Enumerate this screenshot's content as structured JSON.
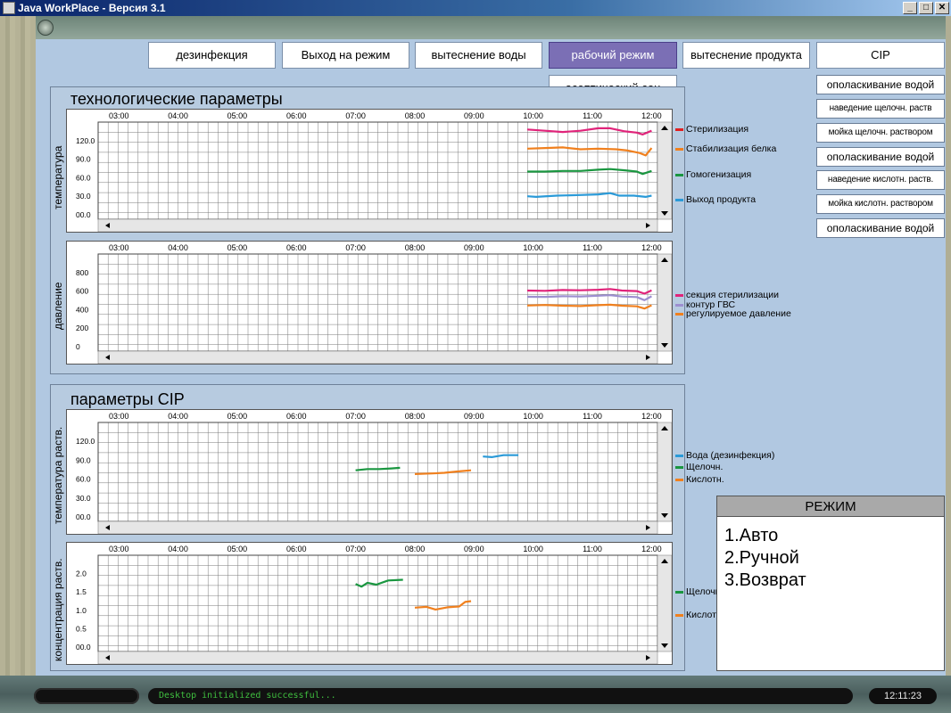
{
  "window": {
    "title": "Java WorkPlace - Версия 3.1",
    "minimize": "_",
    "maximize": "□",
    "close": "✕"
  },
  "mode_buttons": [
    {
      "label": "дезинфекция",
      "active": false
    },
    {
      "label": "Выход на режим",
      "active": false
    },
    {
      "label": "вытеснение воды",
      "active": false
    },
    {
      "label": "рабочий режим",
      "active": true
    },
    {
      "label": "вытеснение продукта",
      "active": false
    },
    {
      "label": "CIP",
      "active": false
    }
  ],
  "aseptic_button": "асептический сон",
  "cip_steps": [
    "ополаскивание водой",
    "наведение щелочн. раств",
    "мойка щелочн. раствором",
    "ополаскивание водой",
    "наведение кислотн. раств.",
    "мойка кислотн. раствором",
    "ополаскивание водой"
  ],
  "colors": {
    "pink": "#e0247a",
    "orange": "#f0801e",
    "green": "#1a9640",
    "blue": "#2a9ad8",
    "lavender": "#9c8fd0",
    "red": "#e02020",
    "active_button": "#7b6fb5"
  },
  "time_ticks": [
    "03:00",
    "04:00",
    "05:00",
    "06:00",
    "07:00",
    "08:00",
    "09:00",
    "10:00",
    "11:00",
    "12:00"
  ],
  "panels": {
    "tech": {
      "title": "технологические параметры"
    },
    "cip": {
      "title": "параметры CIP"
    }
  },
  "charts": [
    {
      "id": "temp",
      "ylabel": "температура",
      "yticks": [
        "120.0",
        "90.0",
        "60.0",
        "30.0",
        "00.0"
      ],
      "ylim": [
        0,
        150
      ],
      "legend": [
        {
          "name": "Стерилизация",
          "color": "#e02020"
        },
        {
          "name": "Стабилизация белка",
          "color": "#f0801e"
        },
        {
          "name": "Гомогенизация",
          "color": "#1a9640"
        },
        {
          "name": "Выход продукта",
          "color": "#2a9ad8"
        }
      ],
      "series": [
        {
          "name": "Стерилизация",
          "color": "#e0247a",
          "points": [
            [
              9.9,
              138
            ],
            [
              10.2,
              136
            ],
            [
              10.5,
              134
            ],
            [
              10.8,
              136
            ],
            [
              11.1,
              140
            ],
            [
              11.3,
              140
            ],
            [
              11.55,
              135
            ],
            [
              11.75,
              133
            ],
            [
              11.85,
              130
            ],
            [
              12.0,
              136
            ]
          ]
        },
        {
          "name": "Стабилизация белка",
          "color": "#f0801e",
          "points": [
            [
              9.9,
              107
            ],
            [
              10.2,
              108
            ],
            [
              10.5,
              109
            ],
            [
              10.8,
              106
            ],
            [
              11.1,
              107
            ],
            [
              11.4,
              106
            ],
            [
              11.6,
              104
            ],
            [
              11.8,
              100
            ],
            [
              11.9,
              96
            ],
            [
              12.0,
              108
            ]
          ]
        },
        {
          "name": "Гомогенизация",
          "color": "#1a9640",
          "points": [
            [
              9.9,
              70
            ],
            [
              10.2,
              70
            ],
            [
              10.5,
              71
            ],
            [
              10.8,
              71
            ],
            [
              11.1,
              73
            ],
            [
              11.3,
              74
            ],
            [
              11.55,
              72
            ],
            [
              11.75,
              70
            ],
            [
              11.85,
              66
            ],
            [
              12.0,
              71
            ]
          ]
        },
        {
          "name": "Выход продукта",
          "color": "#2a9ad8",
          "points": [
            [
              9.9,
              30
            ],
            [
              10.05,
              29
            ],
            [
              10.4,
              31
            ],
            [
              10.8,
              32
            ],
            [
              11.1,
              33
            ],
            [
              11.3,
              35
            ],
            [
              11.45,
              31
            ],
            [
              11.7,
              31
            ],
            [
              11.9,
              29
            ],
            [
              12.0,
              31
            ]
          ]
        }
      ]
    },
    {
      "id": "pressure",
      "ylabel": "давление",
      "yticks": [
        "800",
        "600",
        "400",
        "200",
        "0"
      ],
      "ylim": [
        0,
        900
      ],
      "legend": [
        {
          "name": "секция стерилизации",
          "color": "#e0247a"
        },
        {
          "name": "контур ГВС",
          "color": "#9c8fd0"
        },
        {
          "name": "регулируемое давление",
          "color": "#f0801e"
        }
      ],
      "series": [
        {
          "name": "секция стерилизации",
          "color": "#e0247a",
          "points": [
            [
              9.9,
              545
            ],
            [
              10.2,
              543
            ],
            [
              10.5,
              550
            ],
            [
              10.8,
              548
            ],
            [
              11.1,
              553
            ],
            [
              11.3,
              560
            ],
            [
              11.5,
              545
            ],
            [
              11.75,
              540
            ],
            [
              11.88,
              515
            ],
            [
              12.0,
              548
            ]
          ]
        },
        {
          "name": "контур ГВС",
          "color": "#9c8fd0",
          "points": [
            [
              9.9,
              485
            ],
            [
              10.2,
              484
            ],
            [
              10.5,
              490
            ],
            [
              10.8,
              488
            ],
            [
              11.1,
              495
            ],
            [
              11.3,
              500
            ],
            [
              11.5,
              487
            ],
            [
              11.75,
              482
            ],
            [
              11.88,
              452
            ],
            [
              12.0,
              490
            ]
          ]
        },
        {
          "name": "регулируемое давление",
          "color": "#f0801e",
          "points": [
            [
              9.9,
              400
            ],
            [
              10.2,
              405
            ],
            [
              10.5,
              398
            ],
            [
              10.8,
              395
            ],
            [
              11.1,
              403
            ],
            [
              11.3,
              408
            ],
            [
              11.5,
              398
            ],
            [
              11.75,
              392
            ],
            [
              11.88,
              370
            ],
            [
              12.0,
              402
            ]
          ]
        }
      ]
    },
    {
      "id": "cip_temp",
      "ylabel": "температура раств.",
      "yticks": [
        "120.0",
        "90.0",
        "60.0",
        "30.0",
        "00.0"
      ],
      "ylim": [
        0,
        150
      ],
      "legend": [
        {
          "name": "Вода (дезинфекция)",
          "color": "#2a9ad8"
        },
        {
          "name": "Щелочн.",
          "color": "#1a9640"
        },
        {
          "name": "Кислотн.",
          "color": "#f0801e"
        }
      ],
      "series": [
        {
          "name": "Вода (дезинфекция)",
          "color": "#2a9ad8",
          "points": [
            [
              9.15,
              96
            ],
            [
              9.3,
              95
            ],
            [
              9.5,
              98
            ],
            [
              9.75,
              98
            ]
          ]
        },
        {
          "name": "Щелочн.",
          "color": "#1a9640",
          "points": [
            [
              7.0,
              74
            ],
            [
              7.2,
              76
            ],
            [
              7.4,
              76
            ],
            [
              7.6,
              77
            ],
            [
              7.75,
              78
            ]
          ]
        },
        {
          "name": "Кислотн.",
          "color": "#f0801e",
          "points": [
            [
              8.0,
              68
            ],
            [
              8.3,
              69
            ],
            [
              8.5,
              70
            ],
            [
              8.7,
              72
            ],
            [
              8.95,
              74
            ]
          ]
        }
      ]
    },
    {
      "id": "cip_conc",
      "ylabel": "концентрация раств.",
      "yticks": [
        "2.0",
        "1.5",
        "1.0",
        "0.5",
        "00.0"
      ],
      "ylim": [
        0,
        2.4
      ],
      "legend": [
        {
          "name": "Щелочн.",
          "color": "#1a9640"
        },
        {
          "name": "Кислотн.",
          "color": "#f0801e"
        }
      ],
      "series": [
        {
          "name": "Щелочн.",
          "color": "#1a9640",
          "points": [
            [
              7.0,
              1.65
            ],
            [
              7.1,
              1.58
            ],
            [
              7.2,
              1.68
            ],
            [
              7.35,
              1.63
            ],
            [
              7.55,
              1.74
            ],
            [
              7.8,
              1.76
            ]
          ]
        },
        {
          "name": "Кислотн.",
          "color": "#f0801e",
          "points": [
            [
              8.0,
              1.03
            ],
            [
              8.2,
              1.05
            ],
            [
              8.35,
              0.98
            ],
            [
              8.55,
              1.04
            ],
            [
              8.75,
              1.06
            ],
            [
              8.85,
              1.18
            ],
            [
              8.95,
              1.2
            ]
          ]
        }
      ]
    }
  ],
  "regime": {
    "title": "РЕЖИМ",
    "items": [
      "1.Авто",
      "2.Ручной",
      "3.Возврат"
    ]
  },
  "status": {
    "message": "Desktop initialized successful...",
    "clock": "12:11:23"
  }
}
